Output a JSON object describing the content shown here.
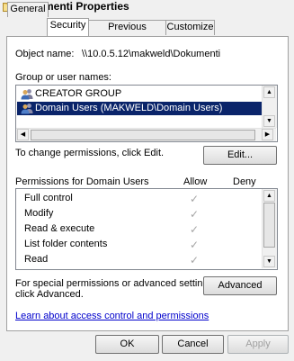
{
  "window": {
    "title": "Dokumenti Properties"
  },
  "tabs": [
    {
      "label": "General"
    },
    {
      "label": "Security"
    },
    {
      "label": "Previous Versions"
    },
    {
      "label": "Customize"
    }
  ],
  "security": {
    "object_name_label": "Object name:",
    "object_name_value": "\\\\10.0.5.12\\makweld\\Dokumenti",
    "groups_label": "Group or user names:",
    "groups": [
      {
        "name": "CREATOR GROUP",
        "icon": "group-icon",
        "selected": false
      },
      {
        "name": "Domain Users (MAKWELD\\Domain Users)",
        "icon": "group-icon",
        "selected": true
      }
    ],
    "change_permissions_text": "To change permissions, click Edit.",
    "edit_button": "Edit...",
    "permissions_label": "Permissions for Domain Users",
    "allow_header": "Allow",
    "deny_header": "Deny",
    "permissions": [
      {
        "name": "Full control",
        "allow": true,
        "deny": false
      },
      {
        "name": "Modify",
        "allow": true,
        "deny": false
      },
      {
        "name": "Read & execute",
        "allow": true,
        "deny": false
      },
      {
        "name": "List folder contents",
        "allow": true,
        "deny": false
      },
      {
        "name": "Read",
        "allow": true,
        "deny": false
      }
    ],
    "special_text_line1": "For special permissions or advanced settings,",
    "special_text_line2": "click Advanced.",
    "advanced_button": "Advanced",
    "learn_link": "Learn about access control and permissions"
  },
  "footer": {
    "ok": "OK",
    "cancel": "Cancel",
    "apply": "Apply"
  },
  "colors": {
    "selection": "#0a246a",
    "link": "#0000cc"
  },
  "icons": {
    "scroll_up": "▲",
    "scroll_down": "▼",
    "scroll_left": "◀",
    "scroll_right": "▶",
    "check": "✓"
  }
}
